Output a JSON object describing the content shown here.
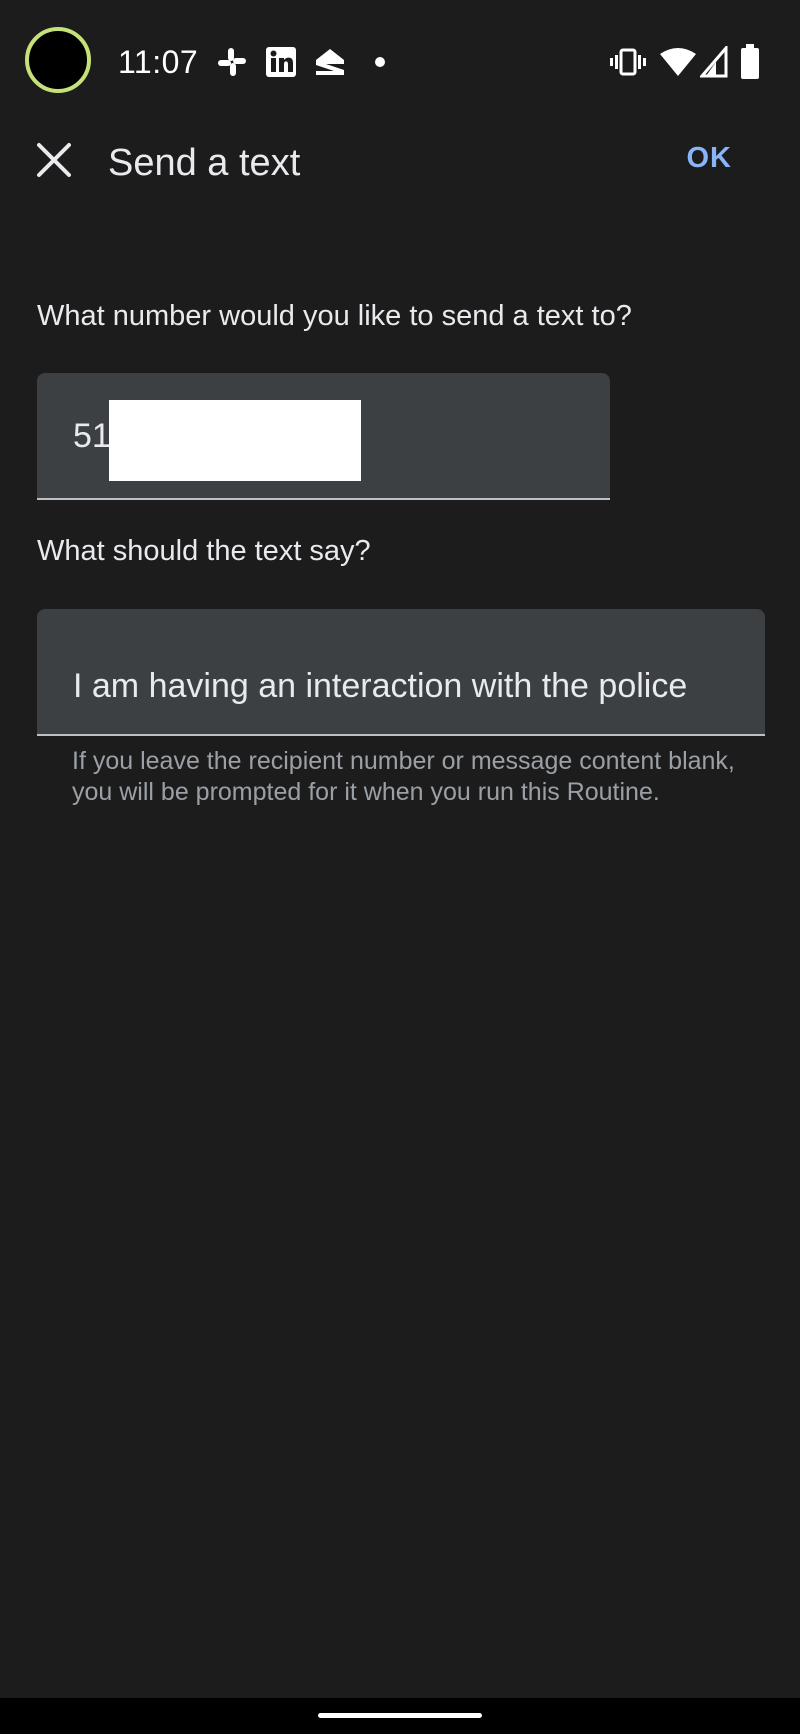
{
  "status_bar": {
    "time": "11:07",
    "notification_icons": [
      "slack-icon",
      "linkedin-icon",
      "zillow-icon",
      "more-dot-icon"
    ],
    "system_icons": [
      "vibrate-icon",
      "wifi-icon",
      "signal-icon",
      "battery-icon"
    ],
    "avatar_ring_color": "#c5e17a"
  },
  "app_bar": {
    "close_icon": "close-icon",
    "title": "Send a text",
    "ok_label": "OK",
    "accent_color": "#8ab4f8"
  },
  "form": {
    "number_question": "What number would you like to send a text to?",
    "number_value": "51",
    "message_question": "What should the text say?",
    "message_value": "I am having an interaction with the police",
    "helper": "If you leave the recipient number or message content blank, you will be prompted for it when you run this Routine."
  },
  "colors": {
    "background": "#1c1c1c",
    "field_background": "#3c4043",
    "helper_text": "#9aa0a6"
  }
}
